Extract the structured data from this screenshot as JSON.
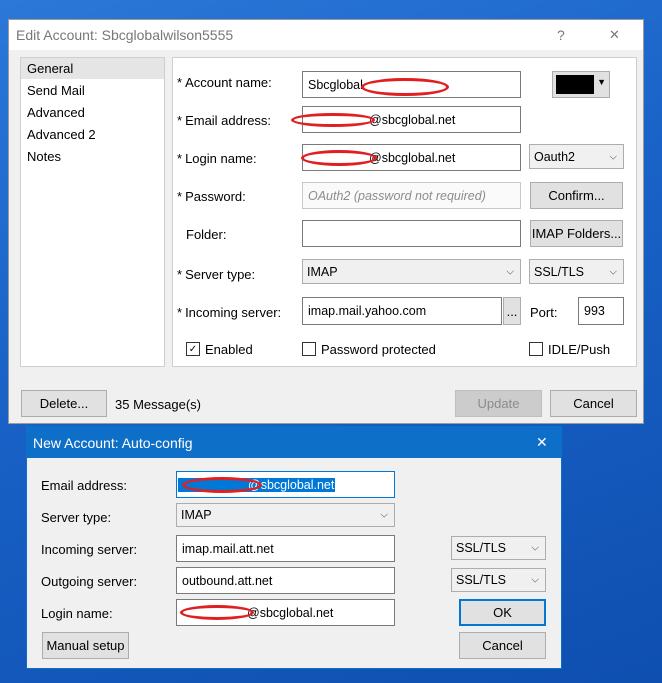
{
  "edit_window": {
    "title": "Edit Account: Sbcglobalwilson5555",
    "help": "?",
    "close": "✕",
    "nav": [
      "General",
      "Send Mail",
      "Advanced",
      "Advanced 2",
      "Notes"
    ],
    "labels": {
      "account_name": "Account name:",
      "email": "Email address:",
      "login": "Login name:",
      "password": "Password:",
      "folder": "Folder:",
      "server_type": "Server type:",
      "incoming": "Incoming server:",
      "port": "Port:",
      "required_mark": "*"
    },
    "values": {
      "account_name": "Sbcglobal",
      "email": "@sbcglobal.net",
      "login": "@sbcglobal.net",
      "password_placeholder": "OAuth2 (password not required)",
      "folder": "",
      "server_type": "IMAP",
      "incoming": "imap.mail.yahoo.com",
      "port": "993",
      "auth": "Oauth2",
      "security": "SSL/TLS"
    },
    "buttons": {
      "confirm": "Confirm...",
      "imap_folders": "IMAP Folders...",
      "browse": "...",
      "delete": "Delete...",
      "update": "Update",
      "cancel": "Cancel"
    },
    "checkboxes": {
      "enabled": "Enabled",
      "password_protected": "Password protected",
      "idle_push": "IDLE/Push"
    },
    "message_count": "35 Message(s)",
    "color_swatch": "#000000"
  },
  "new_window": {
    "title": "New Account: Auto-config",
    "close": "✕",
    "labels": {
      "email": "Email address:",
      "server_type": "Server type:",
      "incoming": "Incoming server:",
      "outgoing": "Outgoing server:",
      "login": "Login name:"
    },
    "values": {
      "email": "@sbcglobal.net",
      "server_type": "IMAP",
      "incoming": "imap.mail.att.net",
      "outgoing": "outbound.att.net",
      "login": "@sbcglobal.net",
      "incoming_security": "SSL/TLS",
      "outgoing_security": "SSL/TLS"
    },
    "buttons": {
      "manual_setup": "Manual setup",
      "ok": "OK",
      "cancel": "Cancel"
    }
  },
  "colors": {
    "accent": "#0078d7",
    "title_active": "#0e6fc9",
    "redaction": "#e02020"
  }
}
